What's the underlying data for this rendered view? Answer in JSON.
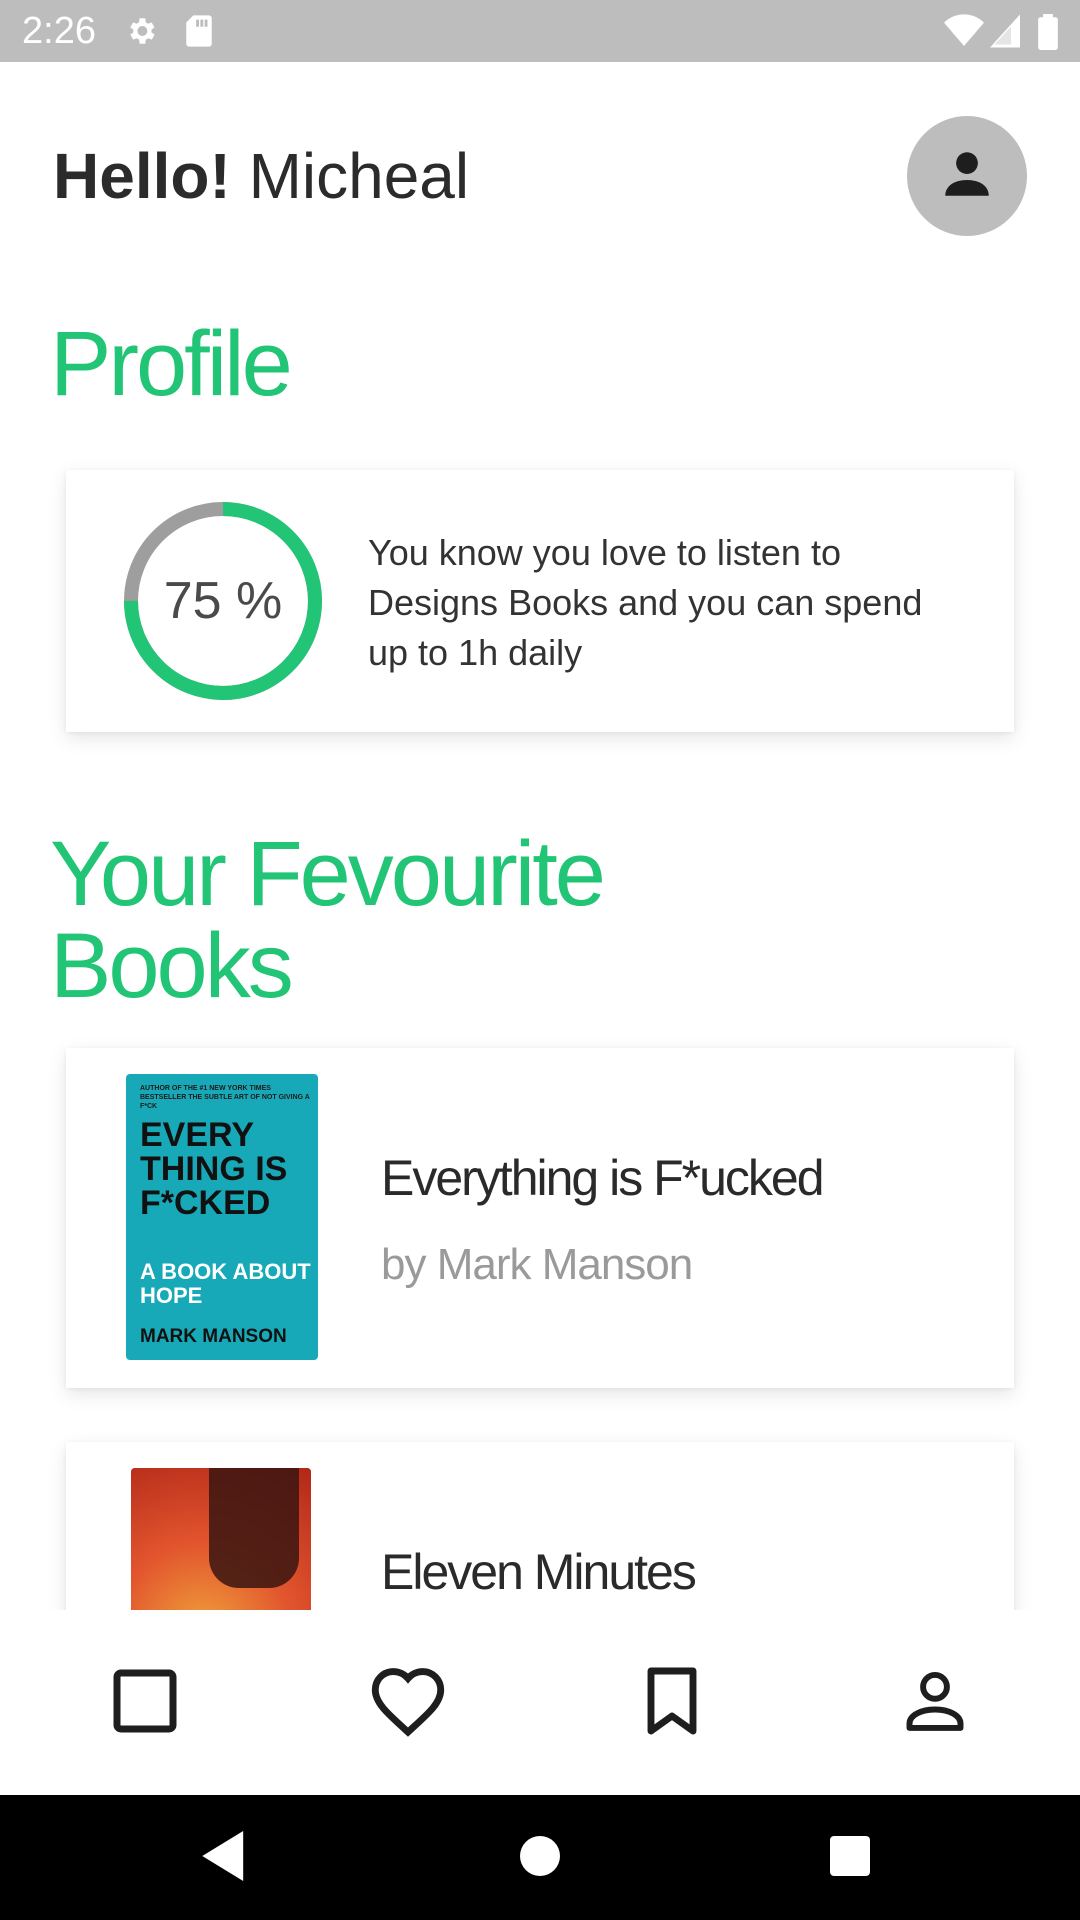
{
  "status_bar": {
    "time": "2:26",
    "icons": [
      "settings-icon",
      "sd-card-icon",
      "wifi-icon",
      "signal-icon",
      "battery-icon"
    ]
  },
  "header": {
    "greeting": "Hello!",
    "user_name": "Micheal",
    "avatar_icon": "person-icon"
  },
  "profile": {
    "title": "Profile",
    "progress_value": 0.75,
    "progress_label": "75 %",
    "description": "You know you love to listen to Designs Books  and you can spend up to 1h daily"
  },
  "favourites": {
    "title": "Your Fevourite Books",
    "books": [
      {
        "title": "Everything is F*ucked",
        "author": "by Mark Manson",
        "cover": {
          "top_text": "AUTHOR OF THE #1 NEW YORK TIMES BESTSELLER THE SUBTLE ART OF NOT GIVING A F*CK",
          "title": "EVERY THING IS F*CKED",
          "subtitle": "A BOOK ABOUT HOPE",
          "author": "MARK MANSON"
        }
      },
      {
        "title": "Eleven Minutes",
        "author": ""
      }
    ]
  },
  "tab_bar": {
    "tabs": [
      "home-square-icon",
      "heart-icon",
      "bookmark-icon",
      "profile-icon"
    ]
  },
  "nav_bar": {
    "buttons": [
      "back-icon",
      "home-icon",
      "recents-icon"
    ]
  },
  "colors": {
    "accent": "#22c476",
    "ring_track": "#9e9e9e",
    "status_bar": "#bdbdbd",
    "cover_teal": "#18a9b8"
  }
}
